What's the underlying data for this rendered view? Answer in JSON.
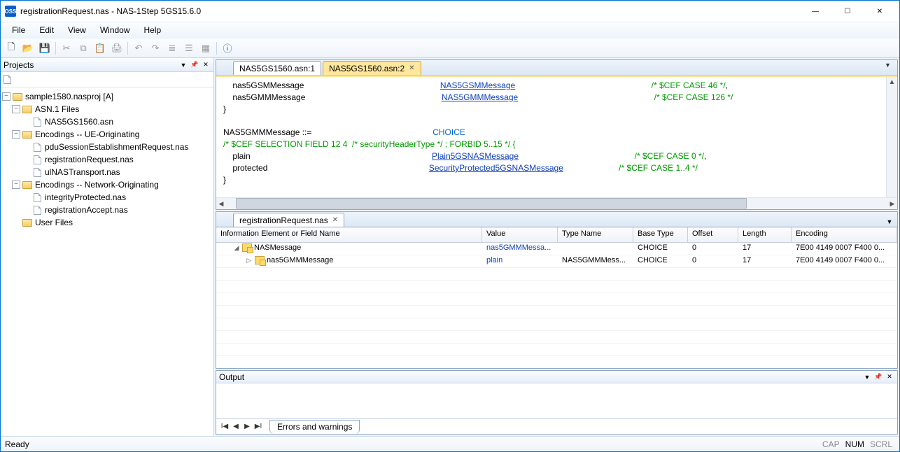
{
  "window": {
    "title": "registrationRequest.nas - NAS-1Step 5GS15.6.0"
  },
  "menu": {
    "file": "File",
    "edit": "Edit",
    "view": "View",
    "window": "Window",
    "help": "Help"
  },
  "projects_panel": {
    "title": "Projects"
  },
  "tree": {
    "root": "sample1580.nasproj [A]",
    "asn1": "ASN.1 Files",
    "asn1_file": "NAS5GS1560.asn",
    "enc_ue": "Encodings -- UE-Originating",
    "ue_file1": "pduSessionEstablishmentRequest.nas",
    "ue_file2": "registrationRequest.nas",
    "ue_file3": "ulNASTransport.nas",
    "enc_net": "Encodings -- Network-Originating",
    "net_file1": "integrityProtected.nas",
    "net_file2": "registrationAccept.nas",
    "user_files": "User Files"
  },
  "editor": {
    "tab1": "NAS5GS1560.asn:1",
    "tab2": "NAS5GS1560.asn:2",
    "line1_a": "    nas5GSMMessage",
    "line1_b": "NAS5GSMMessage",
    "line1_c": "/* $CEF CASE 46 */",
    "line1_d": ",",
    "line2_a": "    nas5GMMMessage",
    "line2_b": "NAS5GMMMessage",
    "line2_c": "/* $CEF CASE 126 */",
    "line3": "}",
    "line5_a": "NAS5GMMMessage ::=",
    "line5_b": "CHOICE",
    "line6": "/* $CEF SELECTION FIELD 12 4  /* securityHeaderType */ ; FORBID 5..15 */ {",
    "line7_a": "    plain",
    "line7_b": "Plain5GSNASMessage",
    "line7_c": "/* $CEF CASE 0 */",
    "line7_d": ",",
    "line8_a": "    protected",
    "line8_b": "SecurityProtected5GSNASMessage",
    "line8_c": "/* $CEF CASE 1..4 */",
    "line9": "}"
  },
  "detail": {
    "tab": "registrationRequest.nas",
    "columns": {
      "name": "Information Element or Field Name",
      "value": "Value",
      "type": "Type Name",
      "base": "Base Type",
      "offset": "Offset",
      "length": "Length",
      "encoding": "Encoding"
    },
    "rows": [
      {
        "indent": 1,
        "exp": "◢",
        "name": "NASMessage",
        "value": "nas5GMMMessa...",
        "type": "",
        "base": "CHOICE",
        "offset": "0",
        "length": "17",
        "encoding": "7E00 4149 0007 F400 0..."
      },
      {
        "indent": 2,
        "exp": "▷",
        "name": "nas5GMMMessage",
        "value": "plain",
        "type": "NAS5GMMMess...",
        "base": "CHOICE",
        "offset": "0",
        "length": "17",
        "encoding": "7E00 4149 0007 F400 0..."
      }
    ]
  },
  "output": {
    "title": "Output",
    "tab": "Errors and warnings"
  },
  "status": {
    "ready": "Ready",
    "cap": "CAP",
    "num": "NUM",
    "scrl": "SCRL"
  }
}
